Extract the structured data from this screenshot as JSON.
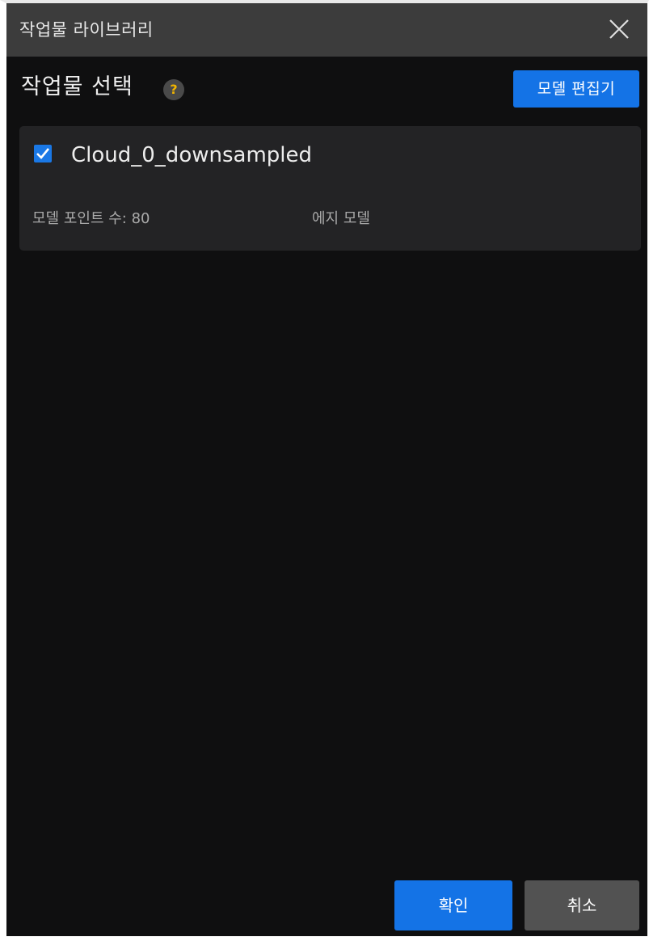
{
  "window": {
    "title": "작업물 라이브러리"
  },
  "header": {
    "section_title": "작업물 선택",
    "help_glyph": "?",
    "edit_button_label": "모델 편집기"
  },
  "models": [
    {
      "name": "Cloud_0_downsampled",
      "checked": true,
      "point_count_text": "모델 포인트 수: 80",
      "model_type": "에지 모델"
    }
  ],
  "footer": {
    "confirm_label": "확인",
    "cancel_label": "취소"
  },
  "colors": {
    "accent": "#1473e6",
    "background": "#0f0f10",
    "titlebar": "#3c3c3c",
    "card": "#232325",
    "help_icon_glyph": "#f0b400",
    "cancel_button": "#525252"
  },
  "icons": {
    "close": "close-icon",
    "help": "help-icon",
    "check": "checkmark-icon"
  }
}
